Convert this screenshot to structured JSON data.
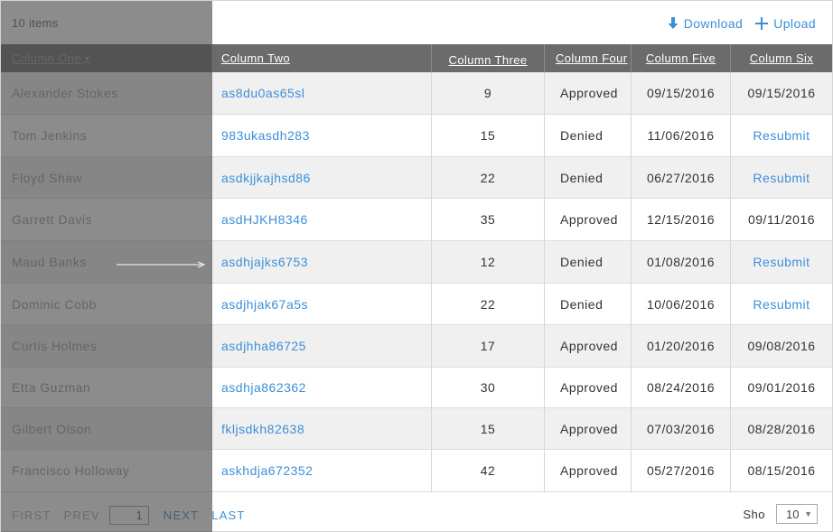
{
  "topbar": {
    "items_count": "10 items",
    "download_label": "Download",
    "upload_label": "Upload",
    "download_icon": "download-arrow-icon",
    "upload_icon": "plus-icon"
  },
  "columns": [
    "Column One",
    "Column Two",
    "Column Three",
    "Column Four",
    "Column Five",
    "Column Six"
  ],
  "rows": [
    {
      "c1": "Alexander Stokes",
      "c2": "as8du0as65sl",
      "c3": "9",
      "c4": "Approved",
      "c5": "09/15/2016",
      "c6": "09/15/2016",
      "c6_link": false
    },
    {
      "c1": "Tom Jenkins",
      "c2": "983ukasdh283",
      "c3": "15",
      "c4": "Denied",
      "c5": "11/06/2016",
      "c6": "Resubmit",
      "c6_link": true
    },
    {
      "c1": "Floyd Shaw",
      "c2": "asdkjjkajhsd86",
      "c3": "22",
      "c4": "Denied",
      "c5": "06/27/2016",
      "c6": "Resubmit",
      "c6_link": true
    },
    {
      "c1": "Garrett Davis",
      "c2": "asdHJKH8346",
      "c3": "35",
      "c4": "Approved",
      "c5": "12/15/2016",
      "c6": "09/11/2016",
      "c6_link": false
    },
    {
      "c1": "Maud Banks",
      "c2": "asdhjajks6753",
      "c3": "12",
      "c4": "Denied",
      "c5": "01/08/2016",
      "c6": "Resubmit",
      "c6_link": true
    },
    {
      "c1": "Dominic Cobb",
      "c2": "asdjhjak67a5s",
      "c3": "22",
      "c4": "Denied",
      "c5": "10/06/2016",
      "c6": "Resubmit",
      "c6_link": true
    },
    {
      "c1": "Curtis Holmes",
      "c2": "asdjhha86725",
      "c3": "17",
      "c4": "Approved",
      "c5": "01/20/2016",
      "c6": "09/08/2016",
      "c6_link": false
    },
    {
      "c1": "Etta Guzman",
      "c2": "asdhja862362",
      "c3": "30",
      "c4": "Approved",
      "c5": "08/24/2016",
      "c6": "09/01/2016",
      "c6_link": false
    },
    {
      "c1": "Gilbert Olson",
      "c2": "fkljsdkh82638",
      "c3": "15",
      "c4": "Approved",
      "c5": "07/03/2016",
      "c6": "08/28/2016",
      "c6_link": false
    },
    {
      "c1": "Francisco Holloway",
      "c2": "askhdja672352",
      "c3": "42",
      "c4": "Approved",
      "c5": "05/27/2016",
      "c6": "08/15/2016",
      "c6_link": false
    }
  ],
  "pager": {
    "first": "FIRST",
    "prev": "PREV",
    "page": "1",
    "next": "NEXT",
    "last": "LAST",
    "show_label": "Sho",
    "page_size": "10"
  },
  "colors": {
    "accent": "#3d8fd8",
    "header_bg": "#6b6b6b",
    "row_alt": "#f0f0f0"
  }
}
